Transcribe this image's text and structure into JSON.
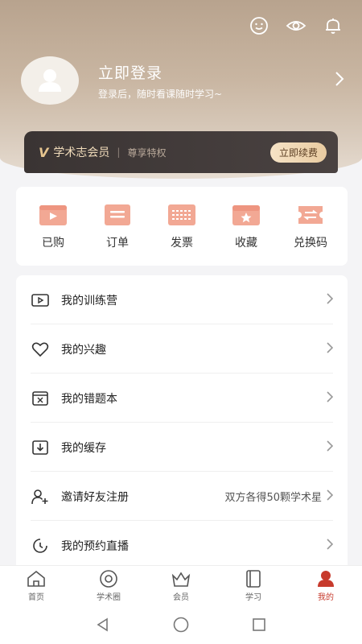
{
  "header": {
    "login_title": "立即登录",
    "login_subtitle": "登录后，随时看课随时学习~",
    "icons": [
      "face-icon",
      "eye-icon",
      "bell-icon"
    ]
  },
  "vip": {
    "badge": "V",
    "name": "学术志会员",
    "separator": "|",
    "privilege": "尊享特权",
    "button": "立即续费"
  },
  "quick_actions": [
    {
      "label": "已购",
      "icon": "purchased-icon"
    },
    {
      "label": "订单",
      "icon": "order-icon"
    },
    {
      "label": "发票",
      "icon": "invoice-icon"
    },
    {
      "label": "收藏",
      "icon": "favorite-icon"
    },
    {
      "label": "兑换码",
      "icon": "redeem-code-icon"
    }
  ],
  "menu": [
    {
      "label": "我的训练营",
      "icon": "video-icon"
    },
    {
      "label": "我的兴趣",
      "icon": "heart-icon"
    },
    {
      "label": "我的错题本",
      "icon": "wrongbook-icon"
    },
    {
      "label": "我的缓存",
      "icon": "download-icon"
    },
    {
      "label": "邀请好友注册",
      "icon": "add-user-icon",
      "extra": "双方各得50颗学术星"
    },
    {
      "label": "我的预约直播",
      "icon": "clock-icon"
    }
  ],
  "tabbar": [
    {
      "label": "首页",
      "icon": "home-icon",
      "active": false
    },
    {
      "label": "学术圈",
      "icon": "circle-icon",
      "active": false
    },
    {
      "label": "会员",
      "icon": "crown-icon",
      "active": false
    },
    {
      "label": "学习",
      "icon": "book-icon",
      "active": false
    },
    {
      "label": "我的",
      "icon": "profile-icon",
      "active": true
    }
  ],
  "colors": {
    "accent": "#c73a2c",
    "quick_icon": "#f2a894",
    "header_top": "#b8a38e",
    "vip_bg": "#3a3433",
    "vip_gold": "#e6c58f"
  }
}
